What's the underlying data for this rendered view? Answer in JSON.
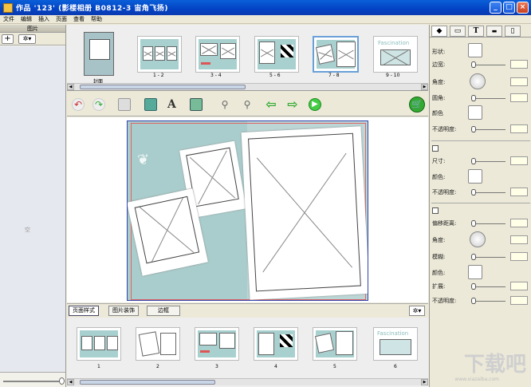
{
  "window": {
    "title": "作品 '123' (影楼相册 B0812-3 宙角飞扬)"
  },
  "menu": [
    "文件",
    "编辑",
    "插入",
    "页面",
    "查看",
    "帮助"
  ],
  "left_panel": {
    "header": "图片",
    "add_label": "+",
    "gear_label": "✲▾",
    "empty_text": "空"
  },
  "top_strip": {
    "cover_label": "封面",
    "pages": [
      "1 - 2",
      "3 - 4",
      "5 - 6",
      "7 - 8",
      "9 - 10"
    ],
    "thumb_text": "Fascination"
  },
  "bottom_tabs": [
    "页面样式",
    "图片装饰",
    "边框"
  ],
  "bottom_strip": {
    "items": [
      "1",
      "2",
      "3",
      "4",
      "5",
      "6"
    ]
  },
  "right_panel": {
    "tabs": [
      "page-icon",
      "frame-icon",
      "T",
      "ruler-icon",
      "doc-icon"
    ],
    "section1": {
      "shape": "形状:",
      "border": "边宽:",
      "angle": "角度:",
      "corner": "圆角:",
      "color": "颜色",
      "opacity": "不透明度:"
    },
    "section2": {
      "size": "尺寸:",
      "color": "颜色:",
      "opacity": "不透明度:"
    },
    "section3": {
      "offset": "偏移距离:",
      "angle": "角度:",
      "blur": "模糊:",
      "color": "颜色:",
      "spread": "扩展:",
      "opacity": "不透明度:"
    }
  },
  "watermark": "下载吧",
  "watermark_sub": "www.xiazaiba.com"
}
